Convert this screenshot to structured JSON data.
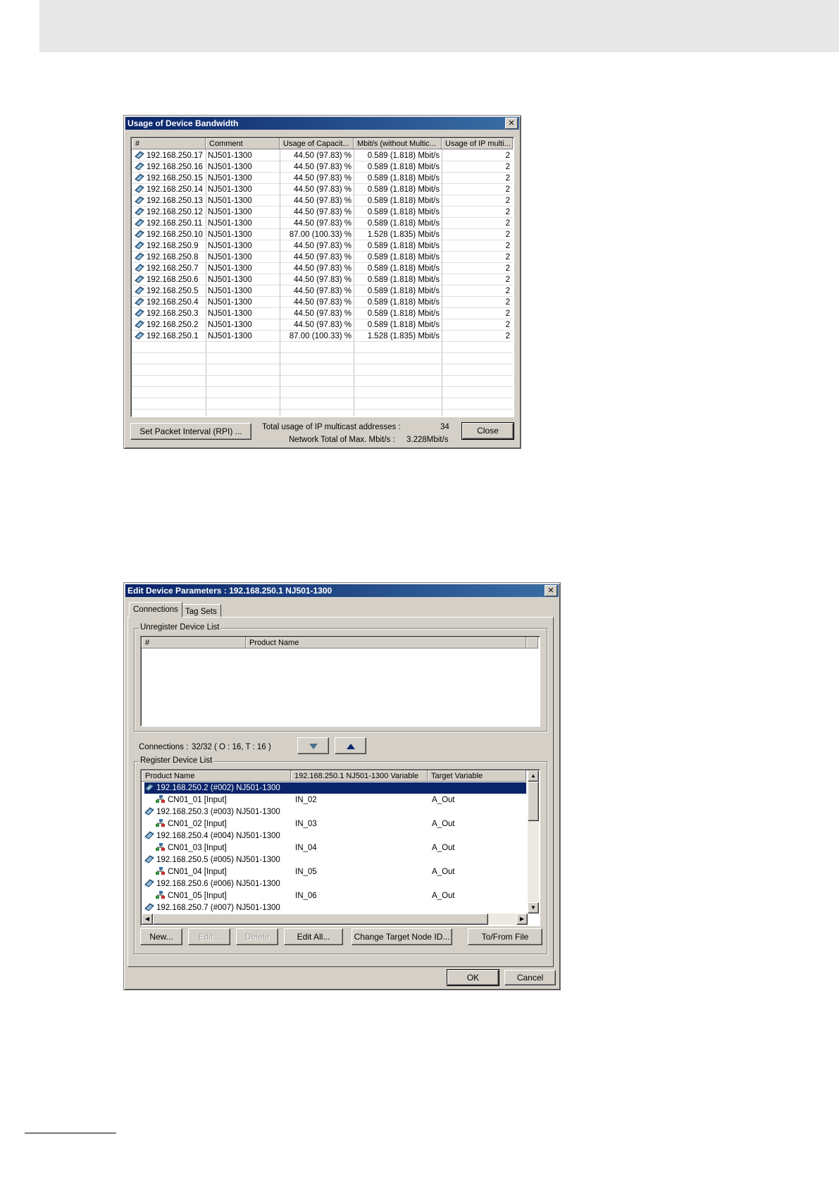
{
  "bandwidth": {
    "title": "Usage of Device Bandwidth",
    "close_x": "✕",
    "columns": [
      "#",
      "Comment",
      "Usage of Capacit...",
      "Mbit/s (without Multic...",
      "Usage of IP multi..."
    ],
    "rows": [
      {
        "addr": "192.168.250.17",
        "comment": "NJ501-1300",
        "usage": "44.50 (97.83) %",
        "mbit": "0.589 (1.818) Mbit/s",
        "ip": "2"
      },
      {
        "addr": "192.168.250.16",
        "comment": "NJ501-1300",
        "usage": "44.50 (97.83) %",
        "mbit": "0.589 (1.818) Mbit/s",
        "ip": "2"
      },
      {
        "addr": "192.168.250.15",
        "comment": "NJ501-1300",
        "usage": "44.50 (97.83) %",
        "mbit": "0.589 (1.818) Mbit/s",
        "ip": "2"
      },
      {
        "addr": "192.168.250.14",
        "comment": "NJ501-1300",
        "usage": "44.50 (97.83) %",
        "mbit": "0.589 (1.818) Mbit/s",
        "ip": "2"
      },
      {
        "addr": "192.168.250.13",
        "comment": "NJ501-1300",
        "usage": "44.50 (97.83) %",
        "mbit": "0.589 (1.818) Mbit/s",
        "ip": "2"
      },
      {
        "addr": "192.168.250.12",
        "comment": "NJ501-1300",
        "usage": "44.50 (97.83) %",
        "mbit": "0.589 (1.818) Mbit/s",
        "ip": "2"
      },
      {
        "addr": "192.168.250.11",
        "comment": "NJ501-1300",
        "usage": "44.50 (97.83) %",
        "mbit": "0.589 (1.818) Mbit/s",
        "ip": "2"
      },
      {
        "addr": "192.168.250.10",
        "comment": "NJ501-1300",
        "usage": "87.00 (100.33) %",
        "mbit": "1.528 (1.835) Mbit/s",
        "ip": "2"
      },
      {
        "addr": "192.168.250.9",
        "comment": "NJ501-1300",
        "usage": "44.50 (97.83) %",
        "mbit": "0.589 (1.818) Mbit/s",
        "ip": "2"
      },
      {
        "addr": "192.168.250.8",
        "comment": "NJ501-1300",
        "usage": "44.50 (97.83) %",
        "mbit": "0.589 (1.818) Mbit/s",
        "ip": "2"
      },
      {
        "addr": "192.168.250.7",
        "comment": "NJ501-1300",
        "usage": "44.50 (97.83) %",
        "mbit": "0.589 (1.818) Mbit/s",
        "ip": "2"
      },
      {
        "addr": "192.168.250.6",
        "comment": "NJ501-1300",
        "usage": "44.50 (97.83) %",
        "mbit": "0.589 (1.818) Mbit/s",
        "ip": "2"
      },
      {
        "addr": "192.168.250.5",
        "comment": "NJ501-1300",
        "usage": "44.50 (97.83) %",
        "mbit": "0.589 (1.818) Mbit/s",
        "ip": "2"
      },
      {
        "addr": "192.168.250.4",
        "comment": "NJ501-1300",
        "usage": "44.50 (97.83) %",
        "mbit": "0.589 (1.818) Mbit/s",
        "ip": "2"
      },
      {
        "addr": "192.168.250.3",
        "comment": "NJ501-1300",
        "usage": "44.50 (97.83) %",
        "mbit": "0.589 (1.818) Mbit/s",
        "ip": "2"
      },
      {
        "addr": "192.168.250.2",
        "comment": "NJ501-1300",
        "usage": "44.50 (97.83) %",
        "mbit": "0.589 (1.818) Mbit/s",
        "ip": "2"
      },
      {
        "addr": "192.168.250.1",
        "comment": "NJ501-1300",
        "usage": "87.00 (100.33) %",
        "mbit": "1.528 (1.835) Mbit/s",
        "ip": "2"
      }
    ],
    "set_packet_button": "Set Packet Interval (RPI) ...",
    "total_ip_label": "Total usage of IP multicast addresses :",
    "total_ip_value": "34",
    "network_total_label": "Network Total of Max. Mbit/s :",
    "network_total_value": "3.228Mbit/s",
    "close_button": "Close"
  },
  "edit": {
    "title": "Edit Device Parameters : 192.168.250.1 NJ501-1300",
    "close_x": "✕",
    "tabs": [
      "Connections",
      "Tag Sets"
    ],
    "unregister_title": "Unregister Device List",
    "unregister_columns": [
      "#",
      "Product Name"
    ],
    "connections_label": "Connections :",
    "connections_value": "32/32 ( O : 16, T : 16 )",
    "register_title": "Register Device List",
    "register_columns": [
      "Product Name",
      "192.168.250.1 NJ501-1300 Variable",
      "Target Variable"
    ],
    "register_rows": [
      {
        "type": "device",
        "name": "192.168.250.2 (#002) NJ501-1300",
        "var": "",
        "target": ""
      },
      {
        "type": "conn",
        "name": "CN01_01 [Input]",
        "var": "IN_02",
        "target": "A_Out"
      },
      {
        "type": "device",
        "name": "192.168.250.3 (#003) NJ501-1300",
        "var": "",
        "target": ""
      },
      {
        "type": "conn",
        "name": "CN01_02 [Input]",
        "var": "IN_03",
        "target": "A_Out"
      },
      {
        "type": "device",
        "name": "192.168.250.4 (#004) NJ501-1300",
        "var": "",
        "target": ""
      },
      {
        "type": "conn",
        "name": "CN01_03 [Input]",
        "var": "IN_04",
        "target": "A_Out"
      },
      {
        "type": "device",
        "name": "192.168.250.5 (#005) NJ501-1300",
        "var": "",
        "target": ""
      },
      {
        "type": "conn",
        "name": "CN01_04 [Input]",
        "var": "IN_05",
        "target": "A_Out"
      },
      {
        "type": "device",
        "name": "192.168.250.6 (#006) NJ501-1300",
        "var": "",
        "target": ""
      },
      {
        "type": "conn",
        "name": "CN01_05 [Input]",
        "var": "IN_06",
        "target": "A_Out"
      },
      {
        "type": "device",
        "name": "192.168.250.7 (#007) NJ501-1300",
        "var": "",
        "target": ""
      }
    ],
    "buttons": {
      "new": "New...",
      "edit": "Edit...",
      "delete": "Delete",
      "edit_all": "Edit All...",
      "change_target": "Change Target Node ID...",
      "to_from_file": "To/From File",
      "ok": "OK",
      "cancel": "Cancel"
    }
  }
}
